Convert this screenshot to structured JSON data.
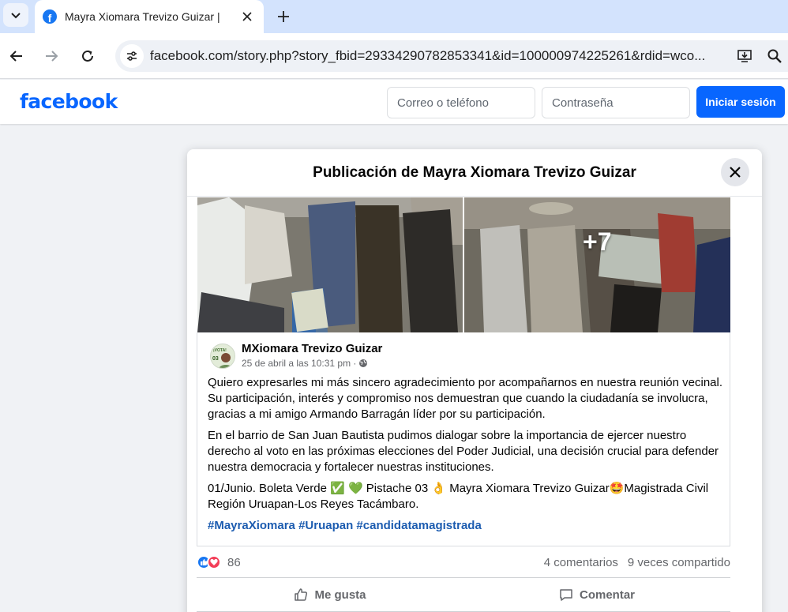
{
  "browser": {
    "tab_title": "Mayra Xiomara Trevizo Guizar |",
    "url": "facebook.com/story.php?story_fbid=29334290782853341&id=100000974225261&rdid=wco..."
  },
  "fb_header": {
    "logo_text": "facebook",
    "email_placeholder": "Correo o teléfono",
    "password_placeholder": "Contraseña",
    "login_button": "Iniciar sesión"
  },
  "modal": {
    "title": "Publicación de Mayra Xiomara Trevizo Guizar",
    "more_photos": "+7",
    "avatar_text": "¡VOTA! 03",
    "author": "MXiomara Trevizo Guizar",
    "timestamp": "25 de abril a las 10:31 pm ·",
    "paragraphs": [
      "Quiero expresarles mi más sincero agradecimiento por acompañarnos en nuestra reunión vecinal. Su participación, interés y compromiso nos demuestran que cuando la ciudadanía se involucra, gracias a mi amigo Armando Barragán líder por su participación.",
      "En el barrio de San Juan Bautista pudimos dialogar sobre la importancia de ejercer nuestro derecho al voto en las próximas elecciones del Poder Judicial, una decisión crucial para defender nuestra democracia y fortalecer nuestras instituciones.",
      "01/Junio. Boleta Verde ✅ 💚 Pistache 03 👌 Mayra Xiomara Trevizo Guizar🤩Magistrada Civil Región Uruapan-Los Reyes Tacámbaro."
    ],
    "hashtags": "#MayraXiomara #Uruapan #candidatamagistrada",
    "reaction_count": "86",
    "comments": "4 comentarios",
    "shares": "9 veces compartido",
    "like_label": "Me gusta",
    "comment_label": "Comentar"
  },
  "colors": {
    "fb_blue": "#0866ff",
    "like_blue": "#1877f2",
    "love_red": "#f33e58",
    "hashtag": "#1c5cb0"
  }
}
